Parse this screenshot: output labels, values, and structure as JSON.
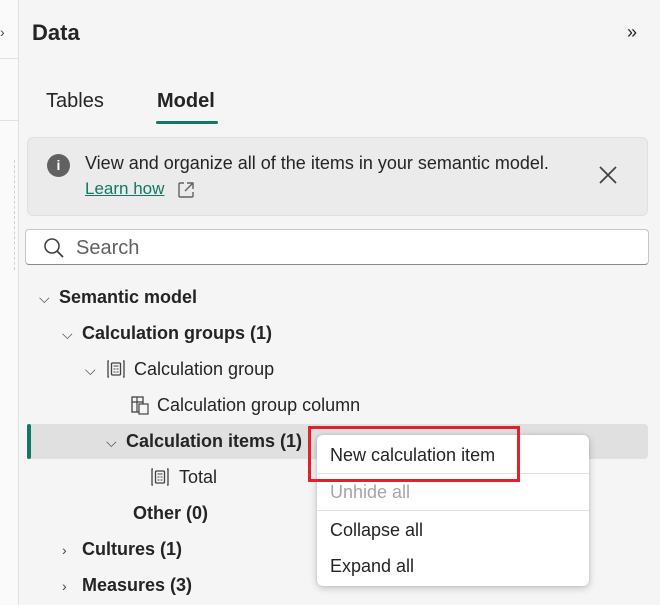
{
  "panel": {
    "title": "Data",
    "collapse_icon": "chevron-double-right-icon"
  },
  "tabs": [
    {
      "label": "Tables",
      "selected": false
    },
    {
      "label": "Model",
      "selected": true
    }
  ],
  "accent_color": "#117865",
  "banner": {
    "text": "View and organize all of the items in your semantic model.",
    "link_label": "Learn how",
    "info_icon": "info-icon",
    "external_icon": "open-external-icon",
    "close_icon": "close-icon"
  },
  "search": {
    "placeholder": "Search",
    "value": ""
  },
  "tree": {
    "semantic_model": "Semantic model",
    "calculation_groups": "Calculation groups (1)",
    "calculation_group": "Calculation group",
    "calculation_group_column": "Calculation group column",
    "calculation_items": "Calculation items (1)",
    "total": "Total",
    "other": "Other (0)",
    "cultures": "Cultures (1)",
    "measures": "Measures (3)"
  },
  "context_menu": {
    "items": [
      {
        "label": "New calculation item",
        "enabled": true
      },
      {
        "label": "Unhide all",
        "enabled": false
      },
      {
        "label": "Collapse all",
        "enabled": true
      },
      {
        "label": "Expand all",
        "enabled": true
      }
    ],
    "highlight_color": "#e3202c"
  }
}
